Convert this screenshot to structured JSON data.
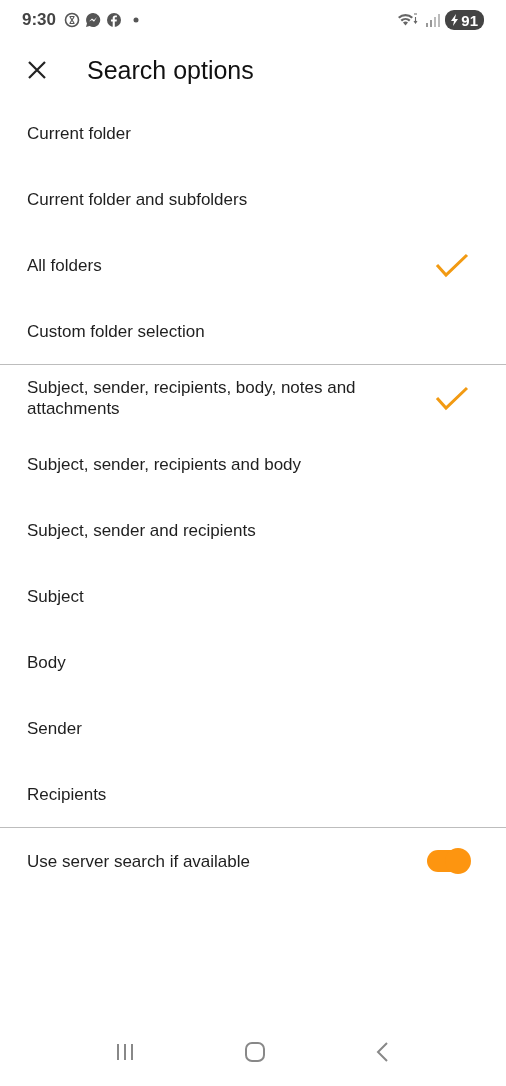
{
  "status_bar": {
    "time": "9:30",
    "battery": "91"
  },
  "header": {
    "title": "Search options"
  },
  "sections": [
    {
      "items": [
        {
          "label": "Current folder",
          "selected": false
        },
        {
          "label": "Current folder and subfolders",
          "selected": false
        },
        {
          "label": "All folders",
          "selected": true
        },
        {
          "label": "Custom folder selection",
          "selected": false
        }
      ]
    },
    {
      "items": [
        {
          "label": "Subject, sender, recipients, body, notes and attachments",
          "selected": true
        },
        {
          "label": "Subject, sender, recipients and body",
          "selected": false
        },
        {
          "label": "Subject, sender and recipients",
          "selected": false
        },
        {
          "label": "Subject",
          "selected": false
        },
        {
          "label": "Body",
          "selected": false
        },
        {
          "label": "Sender",
          "selected": false
        },
        {
          "label": "Recipients",
          "selected": false
        }
      ]
    }
  ],
  "server_search": {
    "label": "Use server search if available",
    "on": true
  }
}
